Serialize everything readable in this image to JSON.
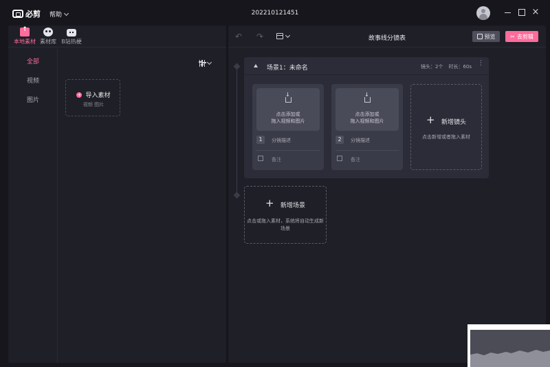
{
  "app": {
    "help_label": "帮助",
    "doc_title": "202210121451"
  },
  "source_tabs": [
    {
      "label": "本地素材"
    },
    {
      "label": "素材库"
    },
    {
      "label": "B站热梗"
    }
  ],
  "categories": [
    "全部",
    "视频",
    "图片"
  ],
  "import_card": {
    "title": "导入素材",
    "subtitle": "视频 图片",
    "badge": "+"
  },
  "storyboard": {
    "title": "故事线分镜表",
    "preview_label": "预览",
    "edit_label": "去剪辑",
    "scene": {
      "title": "场景1：未命名",
      "shots_meta": "镜头：2个",
      "duration_meta": "时长：60s",
      "shots": [
        {
          "hint_line1": "点击添加或",
          "hint_line2": "拖入视频和图片",
          "number": "1",
          "desc": "分镜描述",
          "note": "备注"
        },
        {
          "hint_line1": "点击添加或",
          "hint_line2": "拖入视频和图片",
          "number": "2",
          "desc": "分镜描述",
          "note": "备注"
        }
      ],
      "add_shot_title": "新增镜头",
      "add_shot_sub": "点击新增或者拖入素材"
    },
    "add_scene": {
      "title": "新增场景",
      "sub_line1": "点击或拖入素材，系统将自动生成新",
      "sub_line2": "场景"
    }
  },
  "colors": {
    "accent": "#ff6b9b",
    "background": "#16161c",
    "panel": "#1e1f27",
    "card": "#2b2c37"
  }
}
